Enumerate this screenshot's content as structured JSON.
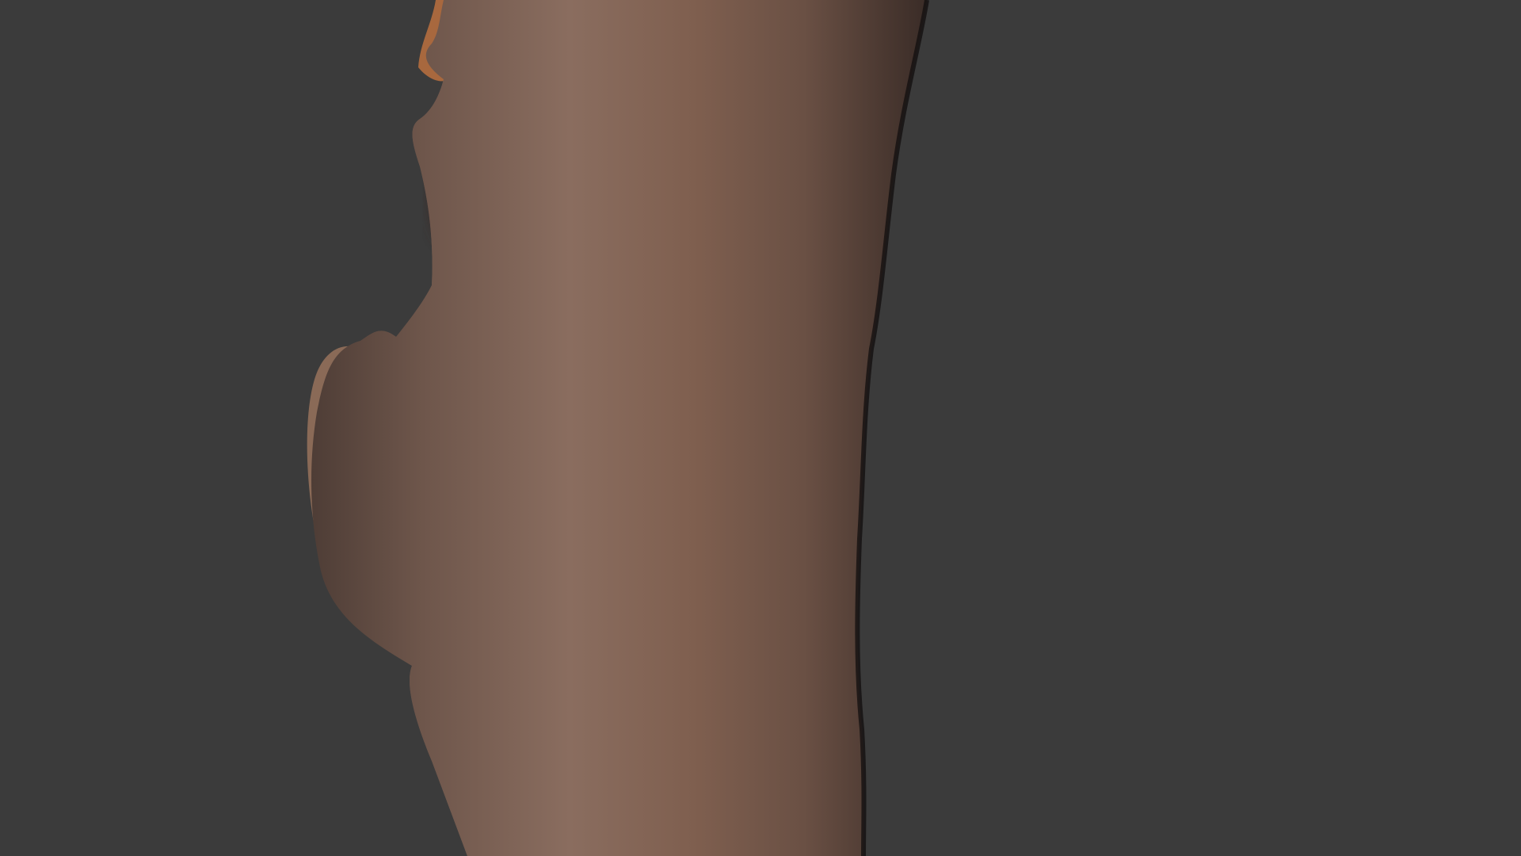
{
  "viewport": {
    "background_color": "#3b3b3b"
  },
  "model": {
    "subject": "tree-stump-scan",
    "render_mode": "textured-wireframe",
    "colors": {
      "bark_base": "#7a5c4f",
      "bark_dark": "#4a3a34",
      "bark_light": "#a08474",
      "heartwood_orange": "#c9803f",
      "cut_face_light": "#d6a76a",
      "cut_face_dark": "#6e3a1f",
      "wire": "#1e1715"
    }
  }
}
